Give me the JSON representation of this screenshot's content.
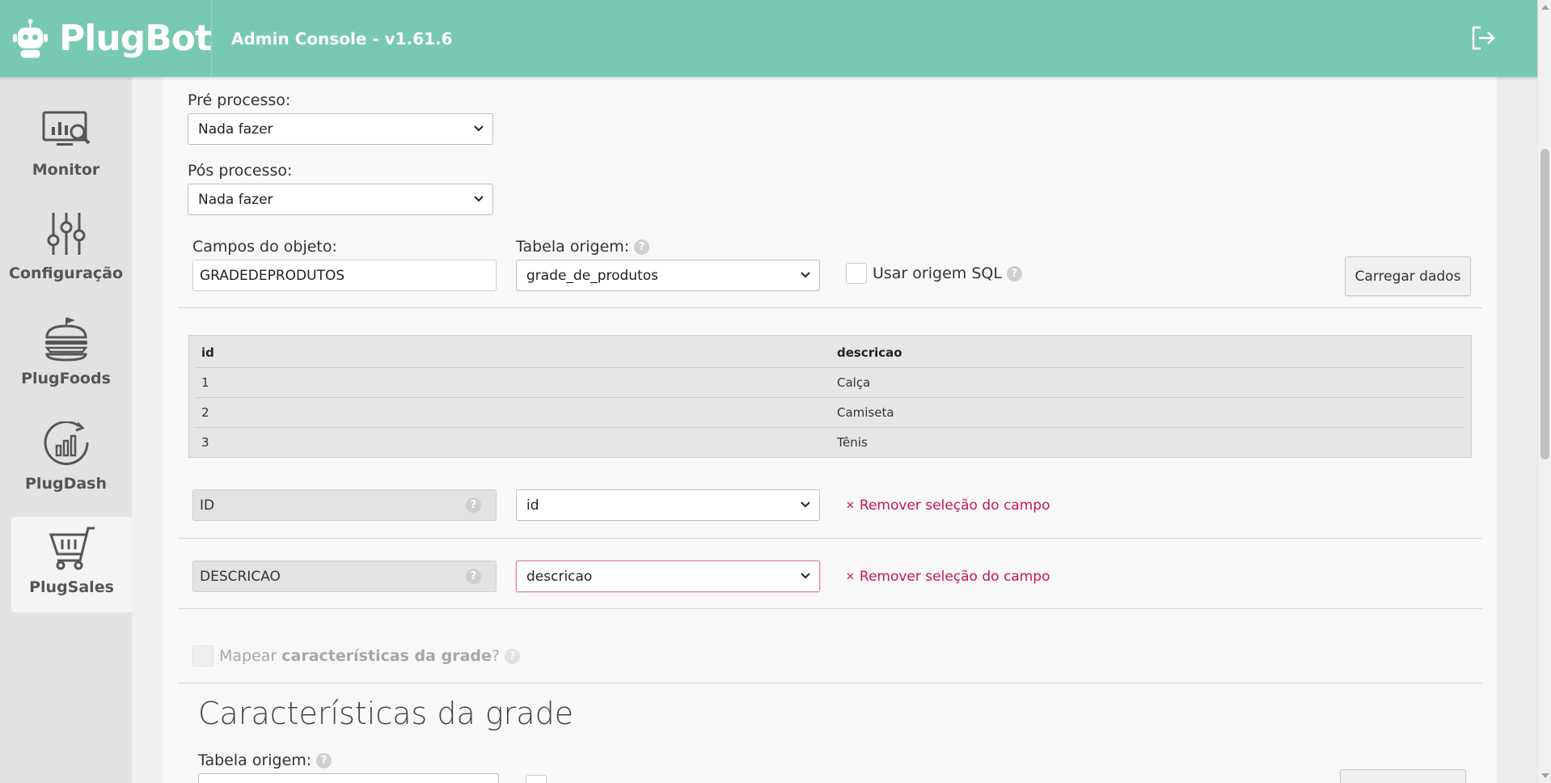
{
  "header": {
    "brand": "PlugBot",
    "title": "Admin Console - v1.61.6",
    "color": "#78c9b2"
  },
  "sidebar": {
    "items": [
      {
        "label": "Monitor",
        "icon": "monitor-chart-icon"
      },
      {
        "label": "Configuração",
        "icon": "sliders-icon"
      },
      {
        "label": "PlugFoods",
        "icon": "burger-icon"
      },
      {
        "label": "PlugDash",
        "icon": "dashboard-chart-icon"
      },
      {
        "label": "PlugSales",
        "icon": "shopping-cart-icon",
        "active": true
      }
    ]
  },
  "form": {
    "pre_process_label": "Pré processo:",
    "pre_process_value": "Nada fazer",
    "post_process_label": "Pós processo:",
    "post_process_value": "Nada fazer",
    "object_fields_label": "Campos do objeto:",
    "object_fields_value": "GRADEDEPRODUTOS",
    "source_table_label": "Tabela origem:",
    "source_table_value": "grade_de_produtos",
    "use_sql_label": "Usar origem SQL",
    "load_button": "Carregar dados",
    "help_glyph": "?"
  },
  "table": {
    "columns": [
      "id",
      "descricao"
    ],
    "rows": [
      [
        "1",
        "Calça"
      ],
      [
        "2",
        "Camiseta"
      ],
      [
        "3",
        "Tênis"
      ]
    ]
  },
  "mappings": [
    {
      "field": "ID",
      "value": "id",
      "remove": "Remover seleção do campo"
    },
    {
      "field": "DESCRICAO",
      "value": "descricao",
      "remove": "Remover seleção do campo"
    }
  ],
  "grid_characteristics": {
    "checkbox_prefix": "Mapear ",
    "checkbox_bold": "características da grade",
    "checkbox_suffix": "?",
    "section_title": "Características da grade",
    "source_table_label": "Tabela origem:"
  },
  "colors": {
    "accent": "#78c9b2",
    "remove_link": "#c8184a"
  }
}
